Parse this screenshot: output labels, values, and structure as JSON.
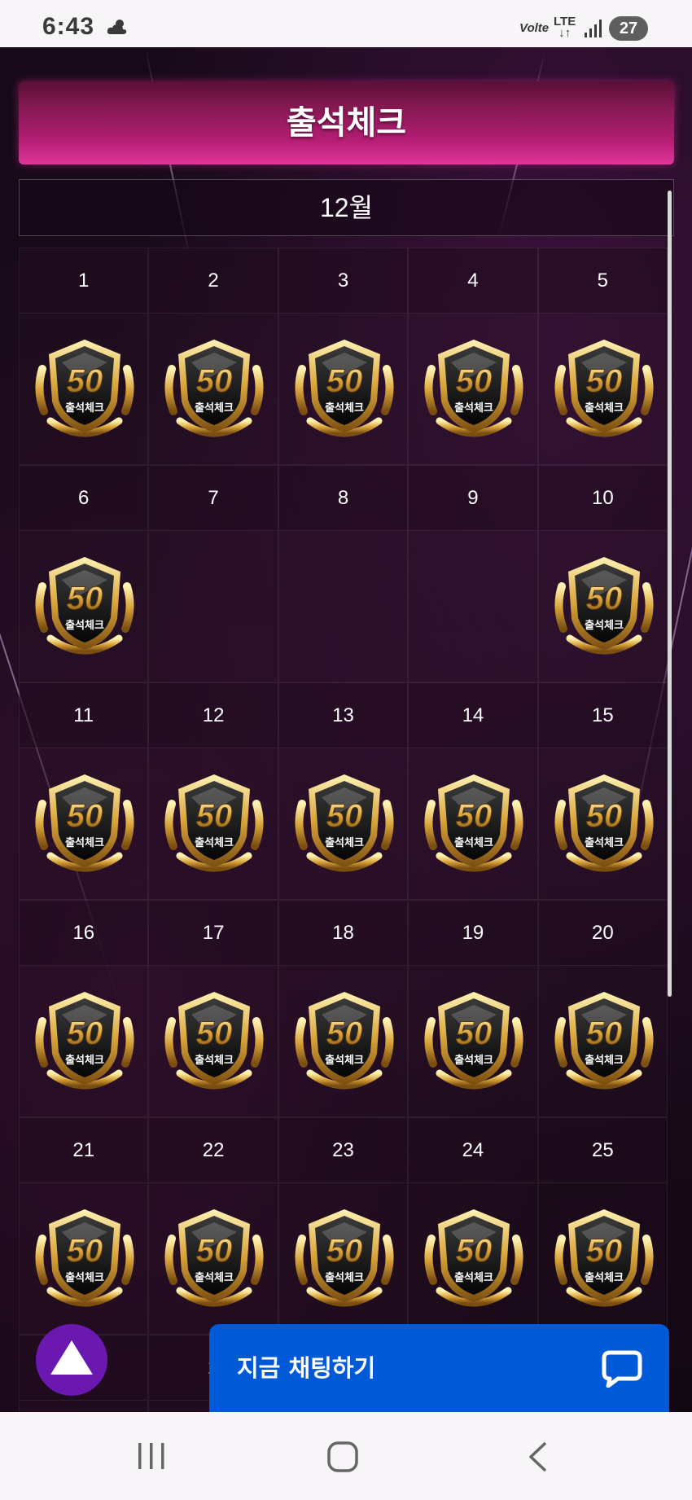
{
  "status_bar": {
    "time": "6:43",
    "volte": "Volte",
    "network": "LTE",
    "battery": "27"
  },
  "page": {
    "title": "출석체크",
    "month": "12월"
  },
  "badge": {
    "number": "50",
    "label": "출석체크"
  },
  "calendar": {
    "days": [
      {
        "day": "1",
        "checked": true
      },
      {
        "day": "2",
        "checked": true
      },
      {
        "day": "3",
        "checked": true
      },
      {
        "day": "4",
        "checked": true
      },
      {
        "day": "5",
        "checked": true
      },
      {
        "day": "6",
        "checked": true
      },
      {
        "day": "7",
        "checked": false
      },
      {
        "day": "8",
        "checked": false
      },
      {
        "day": "9",
        "checked": false
      },
      {
        "day": "10",
        "checked": true
      },
      {
        "day": "11",
        "checked": true
      },
      {
        "day": "12",
        "checked": true
      },
      {
        "day": "13",
        "checked": true
      },
      {
        "day": "14",
        "checked": true
      },
      {
        "day": "15",
        "checked": true
      },
      {
        "day": "16",
        "checked": true
      },
      {
        "day": "17",
        "checked": true
      },
      {
        "day": "18",
        "checked": true
      },
      {
        "day": "19",
        "checked": true
      },
      {
        "day": "20",
        "checked": true
      },
      {
        "day": "21",
        "checked": true
      },
      {
        "day": "22",
        "checked": true
      },
      {
        "day": "23",
        "checked": true
      },
      {
        "day": "24",
        "checked": true
      },
      {
        "day": "25",
        "checked": true
      },
      {
        "day": "",
        "checked": false
      },
      {
        "day": "2",
        "checked": false
      },
      {
        "day": "",
        "checked": false
      },
      {
        "day": "",
        "checked": false
      },
      {
        "day": "",
        "checked": false
      }
    ]
  },
  "chat_button": {
    "label": "지금 채팅하기",
    "icon": "chat-bubble-icon"
  },
  "scroll_top_button": {
    "icon": "triangle-up-icon"
  },
  "nav_bar": {
    "items": [
      "recent-apps-icon",
      "home-icon",
      "back-icon"
    ]
  },
  "colors": {
    "title_gradient": "#b21d72",
    "chat_button": "#0059d6",
    "scroll_top_button": "#6a18b0",
    "badge_gold": "#d9a43a"
  }
}
